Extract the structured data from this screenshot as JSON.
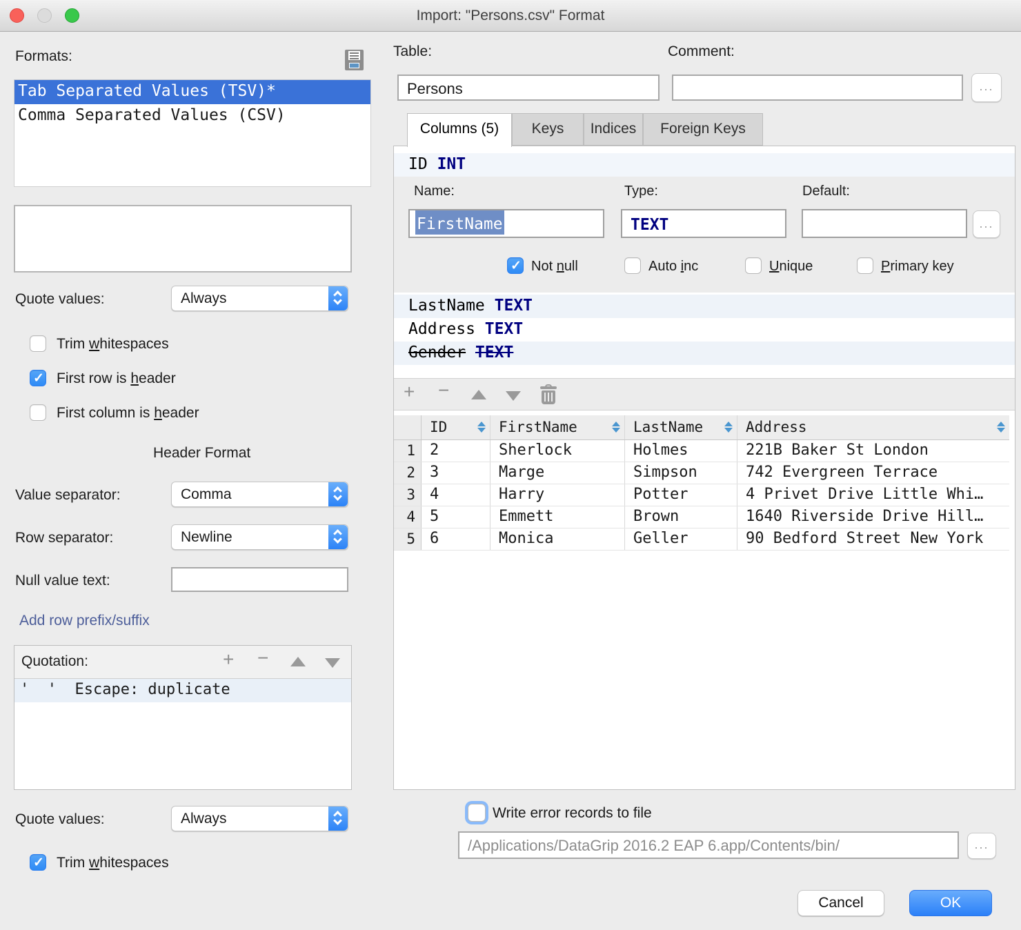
{
  "window": {
    "title": "Import: \"Persons.csv\" Format"
  },
  "formats": {
    "label": "Formats:",
    "items": [
      {
        "label": "Tab Separated Values (TSV)*"
      },
      {
        "label": "Comma Separated Values (CSV)"
      }
    ]
  },
  "left": {
    "quote_values_label": "Quote values:",
    "quote_values_value": "Always",
    "trim_whitespaces": {
      "pre": "Trim ",
      "u": "w",
      "post": "hitespaces"
    },
    "first_row": {
      "pre": "First row is ",
      "u": "h",
      "post": "eader"
    },
    "first_column": {
      "pre": "First column is ",
      "u": "h",
      "post": "eader"
    },
    "header_format": "Header Format",
    "value_separator_label": "Value separator:",
    "value_separator_value": "Comma",
    "row_separator_label": "Row separator:",
    "row_separator_value": "Newline",
    "null_value_label": "Null value text:",
    "add_row_link": "Add row prefix/suffix",
    "quotation_label": "Quotation:",
    "quotation_row": "'  '  Escape: duplicate",
    "quote_values2_label": "Quote values:",
    "quote_values2_value": "Always",
    "trim_whitespaces2": {
      "pre": "Trim ",
      "u": "w",
      "post": "hitespaces"
    }
  },
  "right": {
    "table_label": "Table:",
    "table_value": "Persons",
    "comment_label": "Comment:",
    "more_button": "...",
    "tabs": [
      {
        "label": "Columns (5)"
      },
      {
        "label": "Keys"
      },
      {
        "label": "Indices"
      },
      {
        "label": "Foreign Keys"
      }
    ],
    "editor": {
      "selected_row": {
        "name": "ID",
        "type": "INT"
      },
      "name_label": "Name:",
      "name_value": "FirstName",
      "type_label": "Type:",
      "type_value": "TEXT",
      "default_label": "Default:",
      "not_null": {
        "pre": "Not ",
        "u": "n",
        "post": "ull"
      },
      "auto_inc": {
        "pre": "Auto ",
        "u": "i",
        "post": "nc"
      },
      "unique": {
        "pre": "",
        "u": "U",
        "post": "nique"
      },
      "primary_key": {
        "pre": "",
        "u": "P",
        "post": "rimary key"
      },
      "other_columns": [
        {
          "name": "LastName",
          "type": "TEXT"
        },
        {
          "name": "Address",
          "type": "TEXT"
        },
        {
          "name": "Gender",
          "type": "TEXT"
        }
      ]
    },
    "grid": {
      "headers": [
        "ID",
        "FirstName",
        "LastName",
        "Address"
      ],
      "row_numbers": [
        "1",
        "2",
        "3",
        "4",
        "5"
      ],
      "rows": [
        [
          "2",
          "Sherlock",
          "Holmes",
          "221B Baker St London"
        ],
        [
          "3",
          "Marge",
          "Simpson",
          "742 Evergreen Terrace"
        ],
        [
          "4",
          "Harry",
          "Potter",
          "4 Privet Drive Little Whi…"
        ],
        [
          "5",
          "Emmett",
          "Brown",
          "1640 Riverside Drive Hill…"
        ],
        [
          "6",
          "Monica",
          "Geller",
          "90 Bedford Street New York"
        ]
      ]
    },
    "error_records": {
      "label": "Write error records to file",
      "path": "/Applications/DataGrip 2016.2 EAP 6.app/Contents/bin/"
    }
  },
  "footer": {
    "cancel": "Cancel",
    "ok": "OK"
  },
  "colors": {
    "accent": "#2b80f8",
    "selection": "#3a72d8",
    "type_navy": "#000080"
  }
}
